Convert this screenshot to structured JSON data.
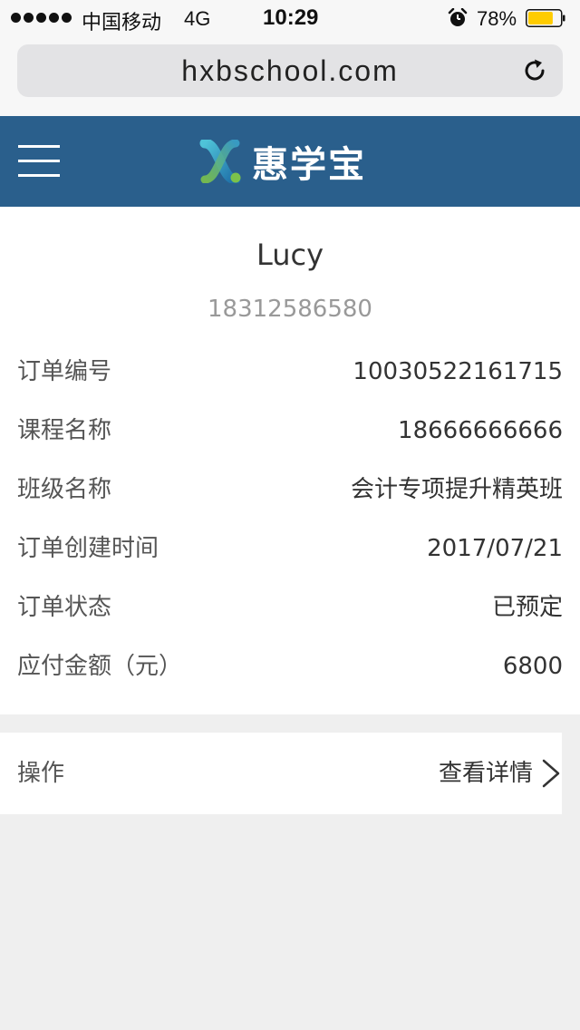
{
  "status_bar": {
    "carrier": "中国移动",
    "network": "4G",
    "time": "10:29",
    "battery_percent": "78%",
    "battery_level": 0.78,
    "battery_color": "#ffcc00",
    "icons": [
      "signal-dots-icon",
      "alarm-icon",
      "battery-icon"
    ]
  },
  "browser": {
    "url": "hxbschool.com",
    "reload_icon": "reload-icon"
  },
  "header": {
    "brand_name": "惠学宝",
    "background_color": "#2a5f8c",
    "menu_icon": "hamburger-menu-icon",
    "logo_icon": "hxb-logo-icon"
  },
  "customer": {
    "name": "Lucy",
    "phone": "18312586580"
  },
  "order_details": [
    {
      "label": "订单编号",
      "value": "10030522161715"
    },
    {
      "label": "课程名称",
      "value": "18666666666"
    },
    {
      "label": "班级名称",
      "value": "会计专项提升精英班"
    },
    {
      "label": "订单创建时间",
      "value": "2017/07/21"
    },
    {
      "label": "订单状态",
      "value": "已预定"
    },
    {
      "label": "应付金额（元）",
      "value": "6800"
    }
  ],
  "action": {
    "label": "操作",
    "link_text": "查看详情",
    "link_icon": "chevron-right-icon"
  }
}
